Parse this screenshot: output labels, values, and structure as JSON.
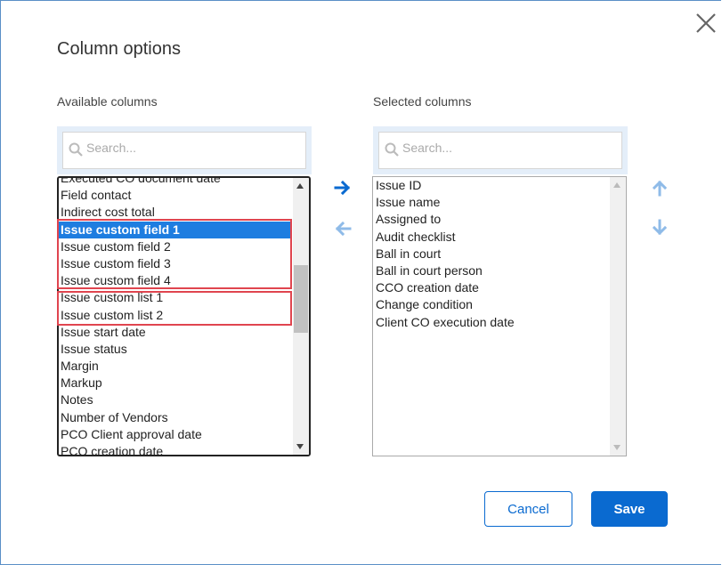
{
  "dialog": {
    "title": "Column options"
  },
  "available": {
    "label": "Available columns",
    "search_placeholder": "Search...",
    "items": [
      "Executed CO document date",
      "Field contact",
      "Indirect cost total",
      "Issue custom field 1",
      "Issue custom field 2",
      "Issue custom field 3",
      "Issue custom field 4",
      "Issue custom list 1",
      "Issue custom list 2",
      "Issue start date",
      "Issue status",
      "Margin",
      "Markup",
      "Notes",
      "Number of Vendors",
      "PCO Client approval date",
      "PCO creation date"
    ],
    "selected_item": "Issue custom field 1"
  },
  "selected": {
    "label": "Selected columns",
    "search_placeholder": "Search...",
    "items": [
      "Issue ID",
      "Issue name",
      "Assigned to",
      "Audit checklist",
      "Ball in court",
      "Ball in court person",
      "CCO creation date",
      "Change condition",
      "Client CO execution date"
    ]
  },
  "buttons": {
    "cancel": "Cancel",
    "save": "Save"
  },
  "colors": {
    "accent": "#0a6ad0",
    "selection": "#1e7de0",
    "highlight_box": "#e0454f",
    "search_bg": "#e4eef9"
  },
  "icons": [
    "close-icon",
    "search-icon",
    "arrow-right-icon",
    "arrow-left-icon",
    "arrow-up-icon",
    "arrow-down-icon"
  ]
}
